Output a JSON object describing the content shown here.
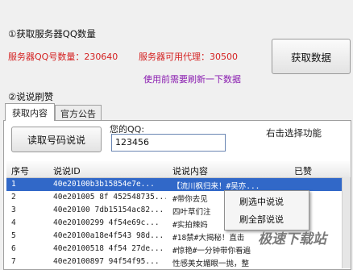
{
  "section1": {
    "title": "①获取服务器QQ数量",
    "server_qq_count": "服务器QQ号数量：230640",
    "server_proxy": "服务器可用代理：30500",
    "notice": "使用前需要刷新一下数据",
    "fetch_button": "获取数据"
  },
  "section2": {
    "title": "②说说刷赞",
    "tabs": [
      "获取内容",
      "官方公告"
    ],
    "read_button": "读取号码说说",
    "qq_label": "您的QQ:",
    "qq_value": "123456",
    "right_hint": "右击选择功能"
  },
  "grid": {
    "headers": [
      "序号",
      "说说ID",
      "说说内容",
      "已赞"
    ],
    "rows": [
      {
        "no": "1",
        "id": "40e20100b3b15854e7e...",
        "content": "【流川枫归来！#吴亦...",
        "liked": ""
      },
      {
        "no": "2",
        "id": "40e201005 8f 452548735...",
        "content": "#带你去见",
        "liked": ""
      },
      {
        "no": "3",
        "id": "40e20100 7db15154ac82...",
        "content": "四叶草们注",
        "liked": ""
      },
      {
        "no": "4",
        "id": "40e20100299 4f54e69c...",
        "content": "#实拍辣妈",
        "liked": ""
      },
      {
        "no": "5",
        "id": "40e20100a18e4f543 98d...",
        "content": "#18禁#大揭秘！直击",
        "liked": ""
      },
      {
        "no": "6",
        "id": "40e20100518 4f54 27de...",
        "content": "#惊艳#一分钟带你看遍",
        "liked": ""
      },
      {
        "no": "7",
        "id": "40e20100897 94f54f95...",
        "content": "性感美女媚眼一抛，整",
        "liked": ""
      }
    ]
  },
  "context_menu": [
    "刷选中说说",
    "刷全部说说"
  ],
  "watermark": "极速下载站"
}
